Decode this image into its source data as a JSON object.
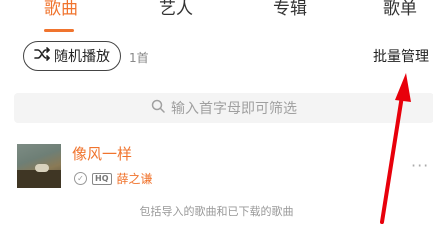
{
  "tabs": [
    {
      "label": "歌曲",
      "active": true
    },
    {
      "label": "艺人",
      "active": false
    },
    {
      "label": "专辑",
      "active": false
    },
    {
      "label": "歌单",
      "active": false
    }
  ],
  "toolbar": {
    "shuffle_label": "随机播放",
    "shuffle_icon": "shuffle-icon",
    "count": "1首",
    "batch_manage_label": "批量管理"
  },
  "search": {
    "placeholder": "输入首字母即可筛选",
    "icon": "search-icon"
  },
  "songs": [
    {
      "title": "像风一样",
      "artist": "薛之谦",
      "quality_badge": "HQ",
      "downloaded": true,
      "more_label": "···"
    }
  ],
  "footer_note": "包括导入的歌曲和已下载的歌曲",
  "colors": {
    "accent": "#f0742e",
    "annotation_arrow": "#e8000b"
  }
}
